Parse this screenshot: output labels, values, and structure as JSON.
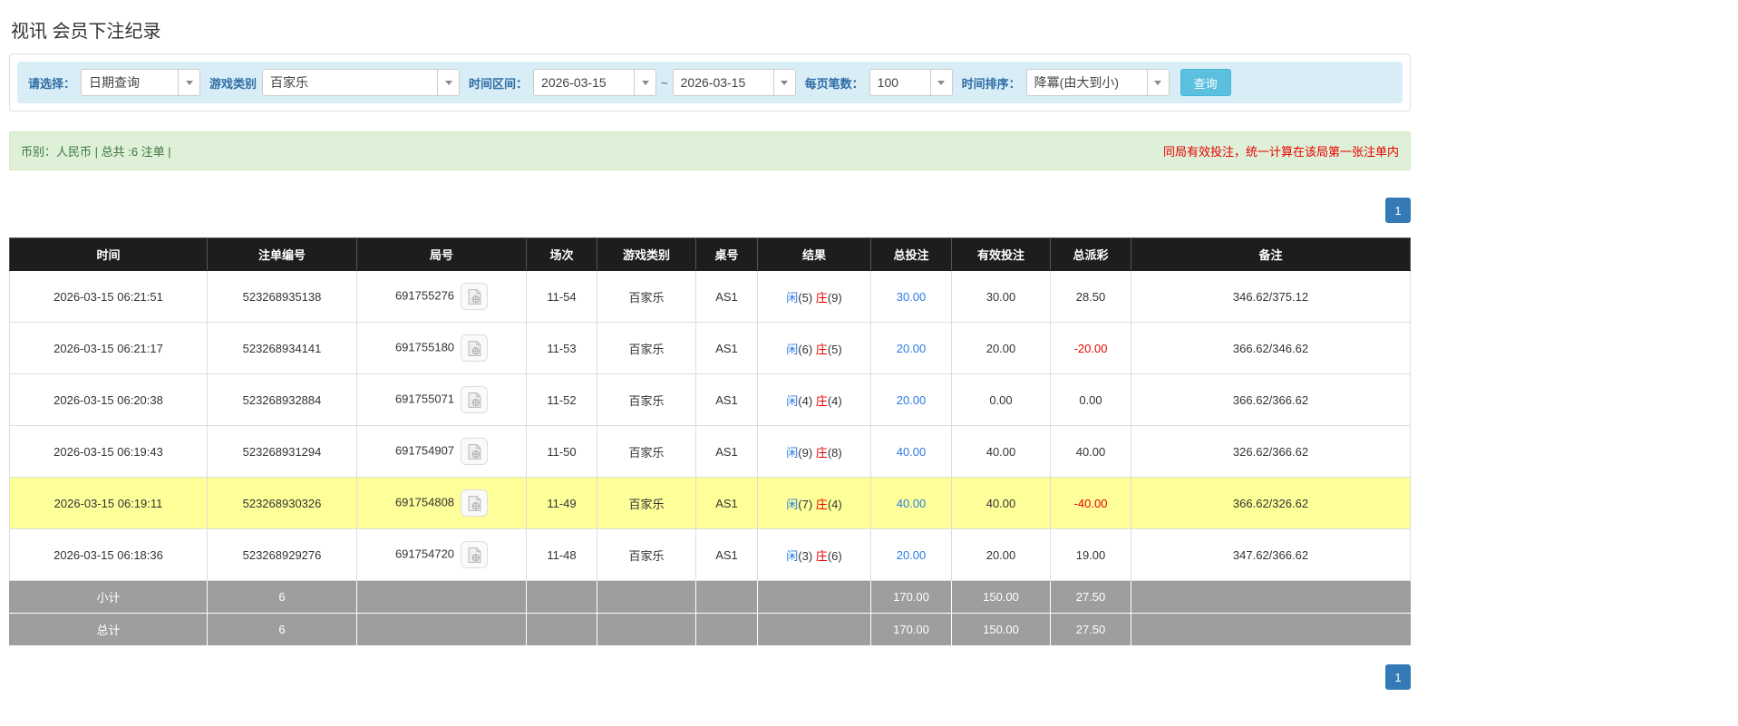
{
  "page": {
    "title": "视讯 会员下注纪录"
  },
  "filters": {
    "select_label": "请选择：",
    "select_value": "日期查询",
    "game_type_label": "游戏类别",
    "game_type_value": "百家乐",
    "time_range_label": "时间区间：",
    "date_from": "2026-03-15",
    "date_separator": "~",
    "date_to": "2026-03-15",
    "page_size_label": "每页笔数：",
    "page_size_value": "100",
    "sort_label": "时间排序：",
    "sort_value": "降冪(由大到小)",
    "search_button_label": "查询"
  },
  "summary": {
    "left_text": "币别：人民币 | 总共 :6 注单 |",
    "right_note": "同局有效投注，统一计算在该局第一张注单内"
  },
  "pagination": {
    "page": "1"
  },
  "colors": {
    "filter_bar_blue": "#d9edf7",
    "filter_label_blue": "#2e6da4",
    "search_button_blue": "#5bc0de",
    "info_green_bg": "#dff0d8",
    "info_green_text": "#3c763d",
    "note_red": "#e60000",
    "header_black": "#1d1d1d",
    "link_blue": "#2a7ae2",
    "banker_red": "#e60000",
    "highlight_yellow": "#ffff99",
    "summary_row_gray": "#9e9e9e",
    "pagination_blue": "#337ab7"
  },
  "table": {
    "headers": [
      "时间",
      "注单编号",
      "局号",
      "场次",
      "游戏类别",
      "桌号",
      "结果",
      "总投注",
      "有效投注",
      "总派彩",
      "备注"
    ],
    "rows": [
      {
        "time": "2026-03-15 06:21:51",
        "bet_id": "523268935138",
        "round_id": "691755276",
        "session": "11-54",
        "game_type": "百家乐",
        "table_no": "AS1",
        "result": {
          "player_label": "闲",
          "player_score": "(5)",
          "banker_label": "庄",
          "banker_score": "(9)"
        },
        "total_bet": "30.00",
        "valid_bet": "30.00",
        "payout": "28.50",
        "payout_negative": false,
        "remark": "346.62/375.12",
        "highlight": false
      },
      {
        "time": "2026-03-15 06:21:17",
        "bet_id": "523268934141",
        "round_id": "691755180",
        "session": "11-53",
        "game_type": "百家乐",
        "table_no": "AS1",
        "result": {
          "player_label": "闲",
          "player_score": "(6)",
          "banker_label": "庄",
          "banker_score": "(5)"
        },
        "total_bet": "20.00",
        "valid_bet": "20.00",
        "payout": "-20.00",
        "payout_negative": true,
        "remark": "366.62/346.62",
        "highlight": false
      },
      {
        "time": "2026-03-15 06:20:38",
        "bet_id": "523268932884",
        "round_id": "691755071",
        "session": "11-52",
        "game_type": "百家乐",
        "table_no": "AS1",
        "result": {
          "player_label": "闲",
          "player_score": "(4)",
          "banker_label": "庄",
          "banker_score": "(4)"
        },
        "total_bet": "20.00",
        "valid_bet": "0.00",
        "payout": "0.00",
        "payout_negative": false,
        "remark": "366.62/366.62",
        "highlight": false
      },
      {
        "time": "2026-03-15 06:19:43",
        "bet_id": "523268931294",
        "round_id": "691754907",
        "session": "11-50",
        "game_type": "百家乐",
        "table_no": "AS1",
        "result": {
          "player_label": "闲",
          "player_score": "(9)",
          "banker_label": "庄",
          "banker_score": "(8)"
        },
        "total_bet": "40.00",
        "valid_bet": "40.00",
        "payout": "40.00",
        "payout_negative": false,
        "remark": "326.62/366.62",
        "highlight": false
      },
      {
        "time": "2026-03-15 06:19:11",
        "bet_id": "523268930326",
        "round_id": "691754808",
        "session": "11-49",
        "game_type": "百家乐",
        "table_no": "AS1",
        "result": {
          "player_label": "闲",
          "player_score": "(7)",
          "banker_label": "庄",
          "banker_score": "(4)"
        },
        "total_bet": "40.00",
        "valid_bet": "40.00",
        "payout": "-40.00",
        "payout_negative": true,
        "remark": "366.62/326.62",
        "highlight": true
      },
      {
        "time": "2026-03-15 06:18:36",
        "bet_id": "523268929276",
        "round_id": "691754720",
        "session": "11-48",
        "game_type": "百家乐",
        "table_no": "AS1",
        "result": {
          "player_label": "闲",
          "player_score": "(3)",
          "banker_label": "庄",
          "banker_score": "(6)"
        },
        "total_bet": "20.00",
        "valid_bet": "20.00",
        "payout": "19.00",
        "payout_negative": false,
        "remark": "347.62/366.62",
        "highlight": false
      }
    ],
    "subtotal": {
      "label": "小计",
      "count": "6",
      "total_bet": "170.00",
      "valid_bet": "150.00",
      "payout": "27.50"
    },
    "total": {
      "label": "总计",
      "count": "6",
      "total_bet": "170.00",
      "valid_bet": "150.00",
      "payout": "27.50"
    }
  }
}
